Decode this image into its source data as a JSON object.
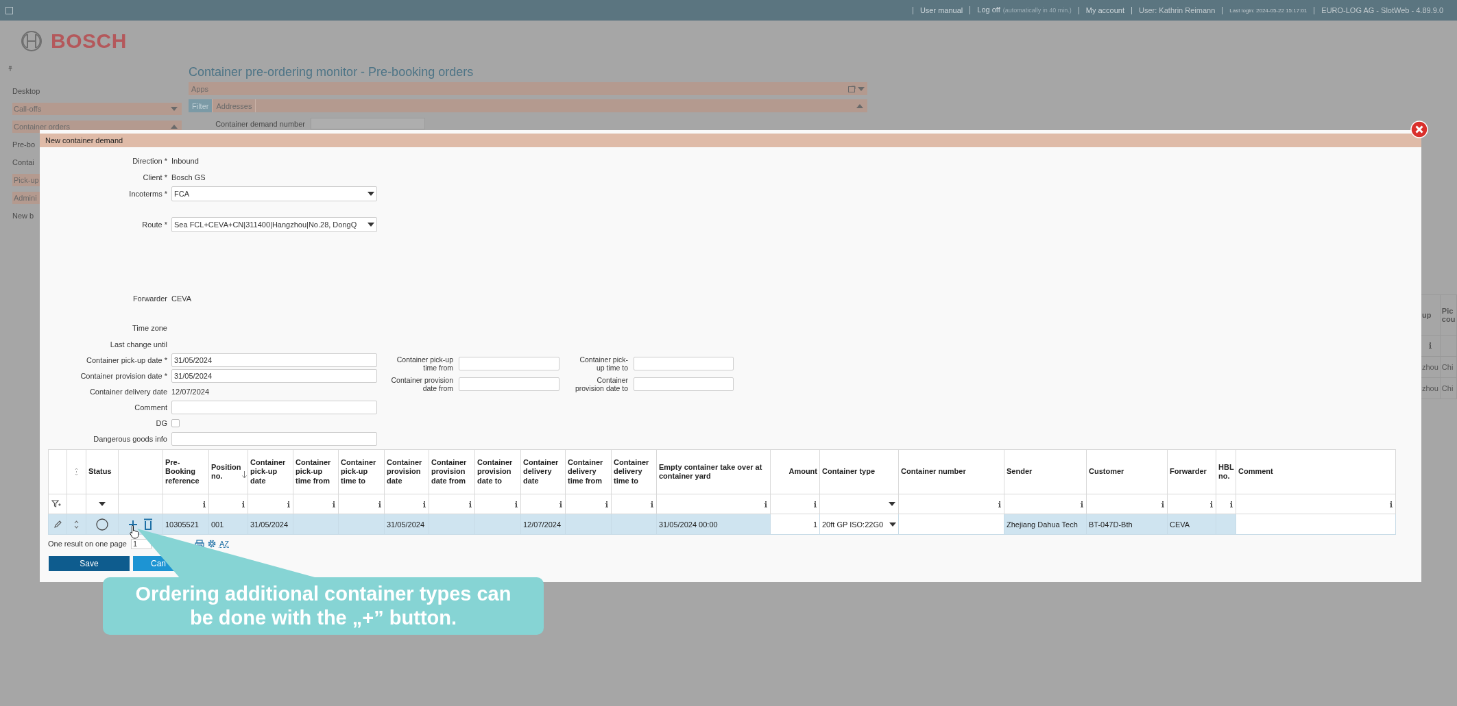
{
  "top_bar": {
    "items": [
      {
        "kind": "link",
        "text": "User manual"
      },
      {
        "kind": "logoff",
        "text": "Log off",
        "note": "(automatically in 40 min.)"
      },
      {
        "kind": "link",
        "text": "My account"
      },
      {
        "kind": "info",
        "text": "User: Kathrin Reimann"
      },
      {
        "kind": "small",
        "text": "Last login: 2024-05-22 15:17:01"
      },
      {
        "kind": "info",
        "text": "EURO-LOG AG - SlotWeb - 4.89.9.0"
      }
    ]
  },
  "logo": {
    "text": "BOSCH"
  },
  "sidebar": {
    "items": [
      {
        "label": "Desktop",
        "kind": "link"
      },
      {
        "label": "Call-offs",
        "kind": "group",
        "expanded": false
      },
      {
        "label": "Container orders",
        "kind": "group",
        "expanded": true
      },
      {
        "label": "Pre-bo",
        "kind": "link"
      },
      {
        "label": "Contai",
        "kind": "link"
      },
      {
        "label": "Pick-up",
        "kind": "group"
      },
      {
        "label": "Admini",
        "kind": "group"
      },
      {
        "label": "New b",
        "kind": "link"
      }
    ]
  },
  "page": {
    "title": "Container pre-ordering monitor - Pre-booking orders",
    "apps_panel": {
      "label": "Apps"
    },
    "filter_tabs": [
      {
        "label": "Filter",
        "selected": true
      },
      {
        "label": "Addresses",
        "selected": false
      }
    ],
    "filter_fields": [
      {
        "label": "Container demand number"
      }
    ]
  },
  "background_table": {
    "headers": [
      "up",
      "Pic cou"
    ],
    "filters": [
      {
        "kind": "info"
      },
      {
        "kind": "none"
      }
    ],
    "rows": [
      [
        "zhou",
        "Chi"
      ],
      [
        "zhou",
        "Chi"
      ]
    ]
  },
  "dialog": {
    "title": "New container demand",
    "form": [
      {
        "label": "Direction *",
        "kind": "text",
        "value": "Inbound"
      },
      {
        "label": "Client *",
        "kind": "text",
        "value": "Bosch GS"
      },
      {
        "label": "Incoterms *",
        "kind": "select",
        "value": "FCA"
      },
      {
        "label": "Route *",
        "kind": "select",
        "value": "Sea FCL+CEVA+CN|311400|Hangzhou|No.28, DongQ"
      },
      {
        "label": "Forwarder",
        "kind": "text",
        "value": "CEVA"
      },
      {
        "label": "Time zone",
        "kind": "text"
      },
      {
        "label": "Last change until",
        "kind": "text"
      },
      {
        "label": "Container pick-up date *",
        "kind": "input",
        "value": "31/05/2024"
      },
      {
        "label": "Container provision date *",
        "kind": "input",
        "value": "31/05/2024"
      },
      {
        "label": "Container delivery date",
        "kind": "text",
        "value": "12/07/2024"
      },
      {
        "label": "Comment",
        "kind": "input"
      },
      {
        "label": "DG",
        "kind": "checkbox",
        "checked": false
      },
      {
        "label": "Dangerous goods info",
        "kind": "input"
      }
    ],
    "side_fields": [
      {
        "label": "Container pick-up time from"
      },
      {
        "label": "Container pick-up time to"
      },
      {
        "label": "Container provision date from"
      },
      {
        "label": "Container provision date to"
      }
    ],
    "table": {
      "columns": [
        {
          "kind": "edit",
          "filter": {
            "kind": "funnel"
          }
        },
        {
          "kind": "reorder",
          "filter": {
            "kind": "none"
          }
        },
        {
          "label": "Status",
          "kind": "status",
          "filter": {
            "kind": "dropdown"
          }
        },
        {
          "kind": "actions",
          "filter": {
            "kind": "none"
          }
        },
        {
          "label": "Pre-Booking reference",
          "kind": "text",
          "filter": {
            "kind": "info"
          }
        },
        {
          "label": "Position no.",
          "kind": "text",
          "filter": {
            "kind": "info"
          },
          "sorted_descending": true
        },
        {
          "label": "Container pick-up date",
          "kind": "text",
          "filter": {
            "kind": "info"
          }
        },
        {
          "label": "Container pick-up time from",
          "kind": "text",
          "filter": {
            "kind": "info"
          }
        },
        {
          "label": "Container pick-up time to",
          "kind": "text",
          "filter": {
            "kind": "info"
          }
        },
        {
          "label": "Container provision date",
          "kind": "text",
          "filter": {
            "kind": "info"
          }
        },
        {
          "label": "Container provision date from",
          "kind": "text",
          "filter": {
            "kind": "info"
          }
        },
        {
          "label": "Container provision date to",
          "kind": "text",
          "filter": {
            "kind": "info"
          }
        },
        {
          "label": "Container delivery date",
          "kind": "text",
          "filter": {
            "kind": "info"
          }
        },
        {
          "label": "Container delivery time from",
          "kind": "text",
          "filter": {
            "kind": "info"
          }
        },
        {
          "label": "Container delivery time to",
          "kind": "text",
          "filter": {
            "kind": "info"
          }
        },
        {
          "label": "Empty container take over at container yard",
          "kind": "text",
          "filter": {
            "kind": "info"
          }
        },
        {
          "label": "Amount",
          "kind": "number",
          "filter": {
            "kind": "info"
          }
        },
        {
          "label": "Container type",
          "kind": "select",
          "filter": {
            "kind": "dropdown"
          }
        },
        {
          "label": "Container number",
          "kind": "input",
          "filter": {
            "kind": "info"
          }
        },
        {
          "label": "Sender",
          "kind": "text",
          "filter": {
            "kind": "info"
          }
        },
        {
          "label": "Customer",
          "kind": "text",
          "filter": {
            "kind": "info"
          }
        },
        {
          "label": "Forwarder",
          "kind": "text",
          "filter": {
            "kind": "info"
          }
        },
        {
          "label": "HBL no.",
          "kind": "text",
          "filter": {
            "kind": "info"
          }
        },
        {
          "label": "Comment",
          "kind": "input",
          "filter": {
            "kind": "info"
          }
        }
      ],
      "rows": [
        {
          "selected": true,
          "cells": [
            null,
            null,
            null,
            null,
            "10305521",
            "001",
            "31/05/2024",
            null,
            null,
            "31/05/2024",
            null,
            null,
            "12/07/2024",
            null,
            null,
            "31/05/2024 00:00",
            "1",
            "20ft GP ISO:22G0",
            null,
            "Zhejiang Dahua Tech",
            "BT-047D-Bth",
            "CEVA",
            null,
            null
          ]
        }
      ]
    },
    "footer": {
      "result_text": "One result on one page",
      "page": "1",
      "sort_label": "AZ"
    },
    "buttons": [
      {
        "label": "Save",
        "kind": "primary"
      },
      {
        "label": "Can",
        "kind": "secondary"
      }
    ]
  },
  "callout": {
    "text": "Ordering additional container types can be done with the „+” button."
  }
}
